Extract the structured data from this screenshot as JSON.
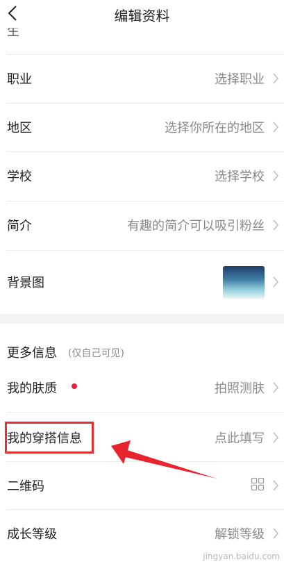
{
  "header": {
    "title": "编辑资料",
    "back_icon": "back-arrow-icon"
  },
  "top_partial_label": "生日",
  "rows": {
    "job": {
      "label": "职业",
      "value": "选择职业"
    },
    "region": {
      "label": "地区",
      "value": "选择你所在的地区"
    },
    "school": {
      "label": "学校",
      "value": "选择学校"
    },
    "intro": {
      "label": "简介",
      "value": "有趣的简介可以吸引粉丝"
    },
    "background": {
      "label": "背景图"
    }
  },
  "more_section": {
    "title": "更多信息",
    "hint": "(仅自己可见)",
    "rows": {
      "skin": {
        "label": "我的肤质",
        "value": "拍照测肤"
      },
      "outfit": {
        "label": "我的穿搭信息",
        "value": "点此填写"
      },
      "qrcode": {
        "label": "二维码",
        "icon": "qr-grid-icon"
      },
      "level": {
        "label": "成长等级",
        "value": "解锁等级"
      }
    }
  },
  "annotation": {
    "highlight_color": "#e03030",
    "arrow_color": "#e8242f"
  },
  "colors": {
    "dot_red": "#e8243f",
    "value_gray": "#8a8a8a"
  },
  "watermark": "jingyan.baidu.com"
}
